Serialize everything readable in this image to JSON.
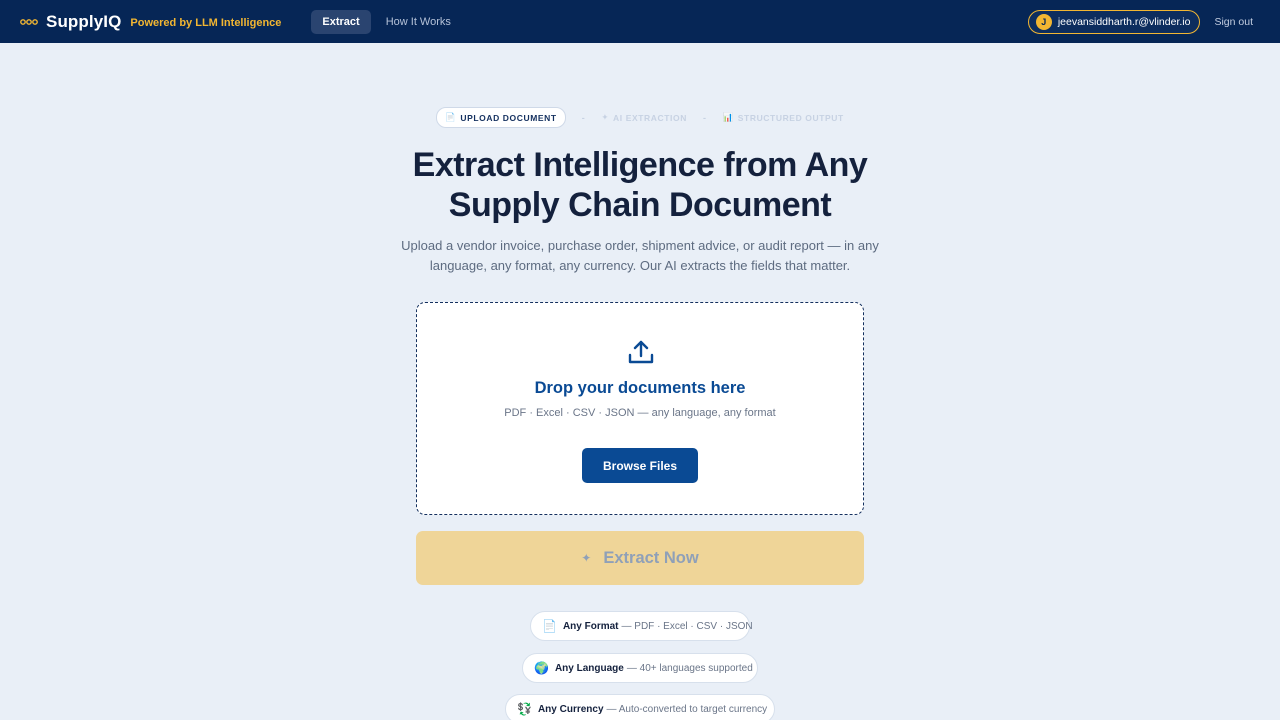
{
  "header": {
    "brand_name": "SupplyIQ",
    "brand_tagline": "Powered by LLM Intelligence",
    "nav": [
      {
        "label": "Extract",
        "active": true
      },
      {
        "label": "How It Works",
        "active": false
      }
    ],
    "user": {
      "initial": "J",
      "email": "jeevansiddharth.r@vlinder.io"
    },
    "signout_label": "Sign out"
  },
  "steps": [
    {
      "icon": "📄",
      "label": "UPLOAD DOCUMENT",
      "active": true
    },
    {
      "icon": "✦",
      "label": "AI EXTRACTION",
      "active": false
    },
    {
      "icon": "📊",
      "label": "STRUCTURED OUTPUT",
      "active": false
    }
  ],
  "step_separator": "-",
  "hero": {
    "title_line1": "Extract Intelligence from Any",
    "title_line2": "Supply Chain Document",
    "subtitle": "Upload a vendor invoice, purchase order, shipment advice, or audit report — in any language, any format, any currency. Our AI extracts the fields that matter."
  },
  "dropzone": {
    "icon": "upload-icon",
    "title": "Drop your documents here",
    "subtitle": "PDF · Excel · CSV · JSON — any language, any format",
    "browse_label": "Browse Files"
  },
  "extract": {
    "icon": "✦",
    "label": "Extract Now"
  },
  "features": [
    {
      "icon": "📄",
      "name": "Any Format",
      "desc": "— PDF · Excel · CSV · JSON"
    },
    {
      "icon": "🌍",
      "name": "Any Language",
      "desc": "— 40+ languages supported"
    },
    {
      "icon": "💱",
      "name": "Any Currency",
      "desc": "— Auto-converted to target currency"
    }
  ],
  "colors": {
    "header_bg": "#062656",
    "accent_gold": "#f2b632",
    "primary_blue": "#0a4a94",
    "page_bg": "#e9eff7"
  }
}
